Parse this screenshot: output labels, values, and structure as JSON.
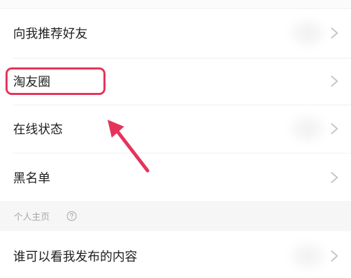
{
  "settings": {
    "rows": [
      {
        "label": "向我推荐好友"
      },
      {
        "label": "淘友圈"
      },
      {
        "label": "在线状态"
      },
      {
        "label": "黑名单"
      }
    ],
    "section_header": {
      "label": "个人主页"
    },
    "bottom_rows": [
      {
        "label": "谁可以看我发布的内容"
      }
    ]
  },
  "annotation": {
    "highlight_color": "#e5345a",
    "arrow_color": "#e5345a"
  },
  "icons": {
    "chevron": "chevron-right-icon",
    "help": "question-circle-icon"
  }
}
